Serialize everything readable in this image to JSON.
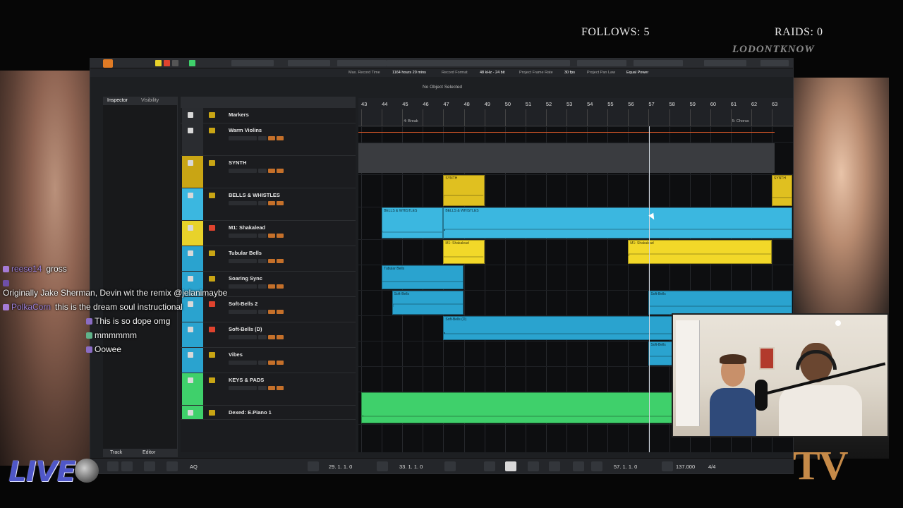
{
  "overlay": {
    "follows": "FOLLOWS: 5",
    "raids": "RAIDS: 0",
    "brand": "LODONTKNOW",
    "live": "LIVE",
    "tv_logo": "TV"
  },
  "daw": {
    "info_bar": [
      "Max. Record Time",
      "1164 hours 20 mins",
      "Record Format",
      "48 kHz - 24 bit",
      "Project Frame Rate",
      "30 fps",
      "Project Pan Law",
      "Equal Power"
    ],
    "status": "No Object Selected",
    "inspector_tabs": [
      "Inspector",
      "Visibility"
    ],
    "bottom_tabs": [
      "Track",
      "Editor"
    ],
    "ruler_bars": [
      "43",
      "44",
      "45",
      "46",
      "47",
      "48",
      "49",
      "50",
      "51",
      "52",
      "53",
      "54",
      "55",
      "56",
      "57",
      "58",
      "59",
      "60",
      "61",
      "62",
      "63"
    ],
    "ruler_markers": [
      {
        "label": "4: Break",
        "bar": 45
      },
      {
        "label": "5: Chorus",
        "bar": 61
      }
    ],
    "tracks": [
      {
        "name": "Markers",
        "color": "#2a2c30",
        "kind": "marker"
      },
      {
        "name": "Warm Violins",
        "color": "#2a2c30",
        "kind": "instrument"
      },
      {
        "name": "SYNTH",
        "color": "#c9a514",
        "kind": "folder"
      },
      {
        "name": "BELLS & WHISTLES",
        "color": "#3bb7e0",
        "kind": "folder"
      },
      {
        "name": "M1: Shakalead",
        "color": "#e8d22a",
        "kind": "instrument"
      },
      {
        "name": "Tubular Bells",
        "color": "#2aa3cf",
        "kind": "instrument"
      },
      {
        "name": "Soaring Sync",
        "color": "#2aa3cf",
        "kind": "instrument"
      },
      {
        "name": "Soft-Bells 2",
        "color": "#2aa3cf",
        "kind": "instrument"
      },
      {
        "name": "Soft-Bells (D)",
        "color": "#2aa3cf",
        "kind": "instrument"
      },
      {
        "name": "Vibes",
        "color": "#2aa3cf",
        "kind": "instrument"
      },
      {
        "name": "KEYS & PADS",
        "color": "#3fd06b",
        "kind": "folder"
      },
      {
        "name": "Dexed: E.Piano 1",
        "color": "#3fd06b",
        "kind": "instrument"
      }
    ],
    "regions": [
      {
        "label": "SYNTH",
        "track": 2,
        "start": 47,
        "end": 49,
        "color": "#e0c020"
      },
      {
        "label": "SYNTH",
        "track": 2,
        "start": 63,
        "end": 64,
        "color": "#e0c020"
      },
      {
        "label": "BELLS & WHISTLES",
        "track": 3,
        "start": 44,
        "end": 47,
        "color": "#3bb7e0"
      },
      {
        "label": "BELLS & WHISTLES",
        "track": 3,
        "start": 47,
        "end": 64,
        "color": "#3bb7e0"
      },
      {
        "label": "M1: Shakalead",
        "track": 4,
        "start": 47,
        "end": 49,
        "color": "#f2d829"
      },
      {
        "label": "M1: Shakalead",
        "track": 4,
        "start": 56,
        "end": 63,
        "color": "#f2d829"
      },
      {
        "label": "Tubular Bells",
        "track": 5,
        "start": 44,
        "end": 48,
        "color": "#2aa3cf"
      },
      {
        "label": "Soft-Bells",
        "track": 6,
        "start": 44.5,
        "end": 48,
        "color": "#2aa3cf"
      },
      {
        "label": "Soft-Bells",
        "track": 6,
        "start": 57,
        "end": 64,
        "color": "#2aa3cf"
      },
      {
        "label": "Soft-Bells (D)",
        "track": 7,
        "start": 47,
        "end": 64,
        "color": "#2aa3cf"
      },
      {
        "label": "Soft-Bells",
        "track": 8,
        "start": 57,
        "end": 64,
        "color": "#2aa3cf"
      },
      {
        "label": "",
        "track": 10,
        "start": 43,
        "end": 64,
        "color": "#3fd06b"
      }
    ],
    "transport": {
      "left_locator": "29. 1. 1. 0",
      "right_locator": "33. 1. 1. 0",
      "position": "57. 1. 1. 0",
      "tempo": "137.000",
      "signature": "4/4",
      "auto_label": "AQ"
    }
  },
  "chat": [
    {
      "user": "reese14",
      "msg": "gross",
      "color": "#a57bd6"
    },
    {
      "user": "",
      "msg": "",
      "color": "#6e4fa8"
    },
    {
      "user": "",
      "msg": "Originally Jake Sherman, Devin wit the remix @jelanimaybe",
      "color": ""
    },
    {
      "user": "PolkaCorn",
      "msg": "this is the dream soul instructional",
      "color": "#a57bd6"
    },
    {
      "user": "",
      "msg": "This is so dope omg",
      "color": "#8a6cc4"
    },
    {
      "user": "",
      "msg": "mmmmmm",
      "color": "#5fb38a"
    },
    {
      "user": "",
      "msg": "Oowee",
      "color": "#8a6cc4"
    }
  ]
}
